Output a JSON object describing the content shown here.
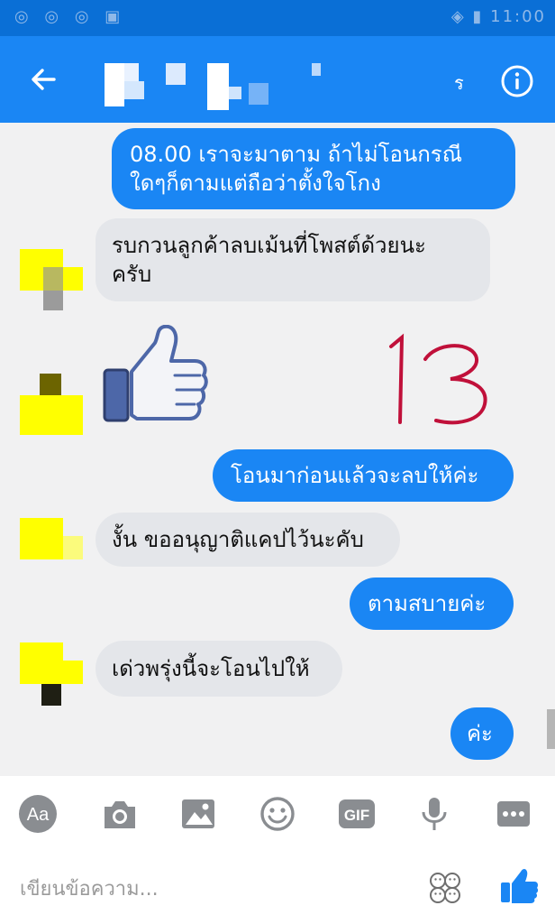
{
  "header": {
    "back_icon": "arrow-back-icon",
    "contact_name_visible": "ร",
    "info_icon": "info-icon"
  },
  "messages": [
    {
      "from": "me",
      "lines": [
        "08.00 เราจะมาตาม ถ้าไม่โอนกรณี",
        "ใดๆก็ตามแต่ถือว่าตั้งใจโกง"
      ]
    },
    {
      "from": "them",
      "lines": [
        "รบกวนลูกค้าลบเม้นที่โพสต์ด้วยนะ",
        "ครับ"
      ]
    },
    {
      "from": "them",
      "type": "like-sticker"
    },
    {
      "from": "me",
      "lines": [
        "โอนมาก่อนแล้วจะลบให้ค่ะ"
      ]
    },
    {
      "from": "them",
      "lines": [
        "งั้น ขออนุญาติแคปไว้นะคับ"
      ]
    },
    {
      "from": "me",
      "lines": [
        "ตามสบายค่ะ"
      ]
    },
    {
      "from": "them",
      "lines": [
        "เด่วพรุ่งนี้จะโอนไปให้"
      ]
    },
    {
      "from": "me",
      "lines": [
        "ค่ะ"
      ]
    }
  ],
  "annotation": {
    "text": "13",
    "color": "#c0103a"
  },
  "toolbar": {
    "icons": [
      "text-style-icon",
      "camera-icon",
      "gallery-icon",
      "emoji-icon",
      "gif-icon",
      "microphone-icon",
      "more-icon"
    ],
    "text_style_label": "Aa",
    "gif_label": "GIF"
  },
  "composer": {
    "placeholder": "เขียนข้อความ...",
    "value": "",
    "send_like_icon": "thumbs-up-icon",
    "emoji_picker_icon": "emoji-faces-icon"
  },
  "colors": {
    "brand": "#1a86f4",
    "incoming_bubble": "#e4e6ea",
    "background": "#f1f1f2",
    "toolbar_icons": "#8a8d91"
  }
}
